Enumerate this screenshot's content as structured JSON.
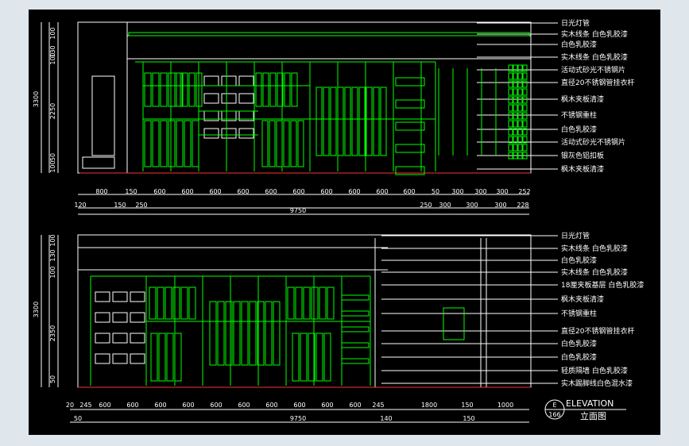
{
  "elevation_top": {
    "notes": [
      "日光灯管",
      "实木线条 白色乳胶漆",
      "白色乳胶漆",
      "实木线条 白色乳胶漆",
      "活动式砂光不锈钢片",
      "直径20不锈钢管挂衣杆",
      "枫木夹板清漆",
      "不锈钢重柱",
      "白色乳胶漆",
      "活动式砂光不锈钢片",
      "银灰色铝扣板",
      "枫木夹板清漆"
    ],
    "dims_row1": [
      "800",
      "150",
      "600",
      "600",
      "600",
      "600",
      "600",
      "600",
      "600",
      "600",
      "600",
      "600",
      "50",
      "300",
      "300",
      "300",
      "252"
    ],
    "dims_row2": [
      "120",
      "150",
      "250",
      "250",
      "300",
      "300",
      "300",
      "228"
    ],
    "total": "9750",
    "vertical": [
      "100",
      "130",
      "100",
      "2250",
      "100",
      "50",
      "3300"
    ]
  },
  "elevation_bottom": {
    "notes": [
      "日光灯管",
      "实木线条 白色乳胶漆",
      "白色乳胶漆",
      "实木线条 白色乳胶漆",
      "18厘夹板基层 白色乳胶漆",
      "枫木夹板清漆",
      "不锈钢重柱",
      "直径20不锈钢管挂衣杆",
      "白色乳胶漆",
      "白色乳胶漆",
      "轻质隔墙 白色乳胶漆",
      "实木踢脚线白色混水漆"
    ],
    "dims_row1": [
      "20",
      "245",
      "600",
      "600",
      "600",
      "600",
      "600",
      "600",
      "600",
      "600",
      "600",
      "600",
      "245",
      "1800",
      "150",
      "1000"
    ],
    "dims_row2": [
      "50",
      "140",
      "150"
    ],
    "total": "9750",
    "vertical": [
      "100",
      "130",
      "100",
      "2350",
      "50",
      "3300"
    ]
  },
  "title_block": {
    "symbol_top": "E",
    "symbol_bottom": "166",
    "title": "ELEVATION",
    "subtitle": "立面图"
  }
}
